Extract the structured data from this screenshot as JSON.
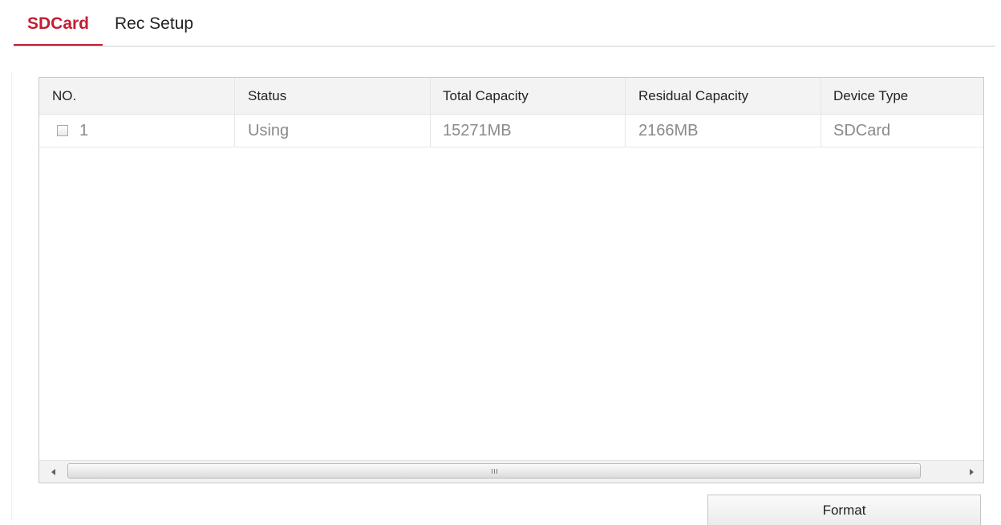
{
  "tabs": [
    {
      "label": "SDCard",
      "active": true
    },
    {
      "label": "Rec Setup",
      "active": false
    }
  ],
  "table": {
    "columns": [
      "NO.",
      "Status",
      "Total Capacity",
      "Residual Capacity",
      "Device Type"
    ],
    "rows": [
      {
        "no": "1",
        "checked": false,
        "status": "Using",
        "total_capacity": "15271MB",
        "residual_capacity": "2166MB",
        "device_type": "SDCard"
      }
    ]
  },
  "actions": {
    "format_label": "Format"
  },
  "colors": {
    "accent": "#c51d33",
    "header_bg": "#f3f3f3",
    "value_text": "#8a8a8a"
  },
  "icons": {
    "scroll_left": "chevron-left-icon",
    "scroll_right": "chevron-right-icon",
    "scroll_grip": "scroll-grip-icon"
  }
}
